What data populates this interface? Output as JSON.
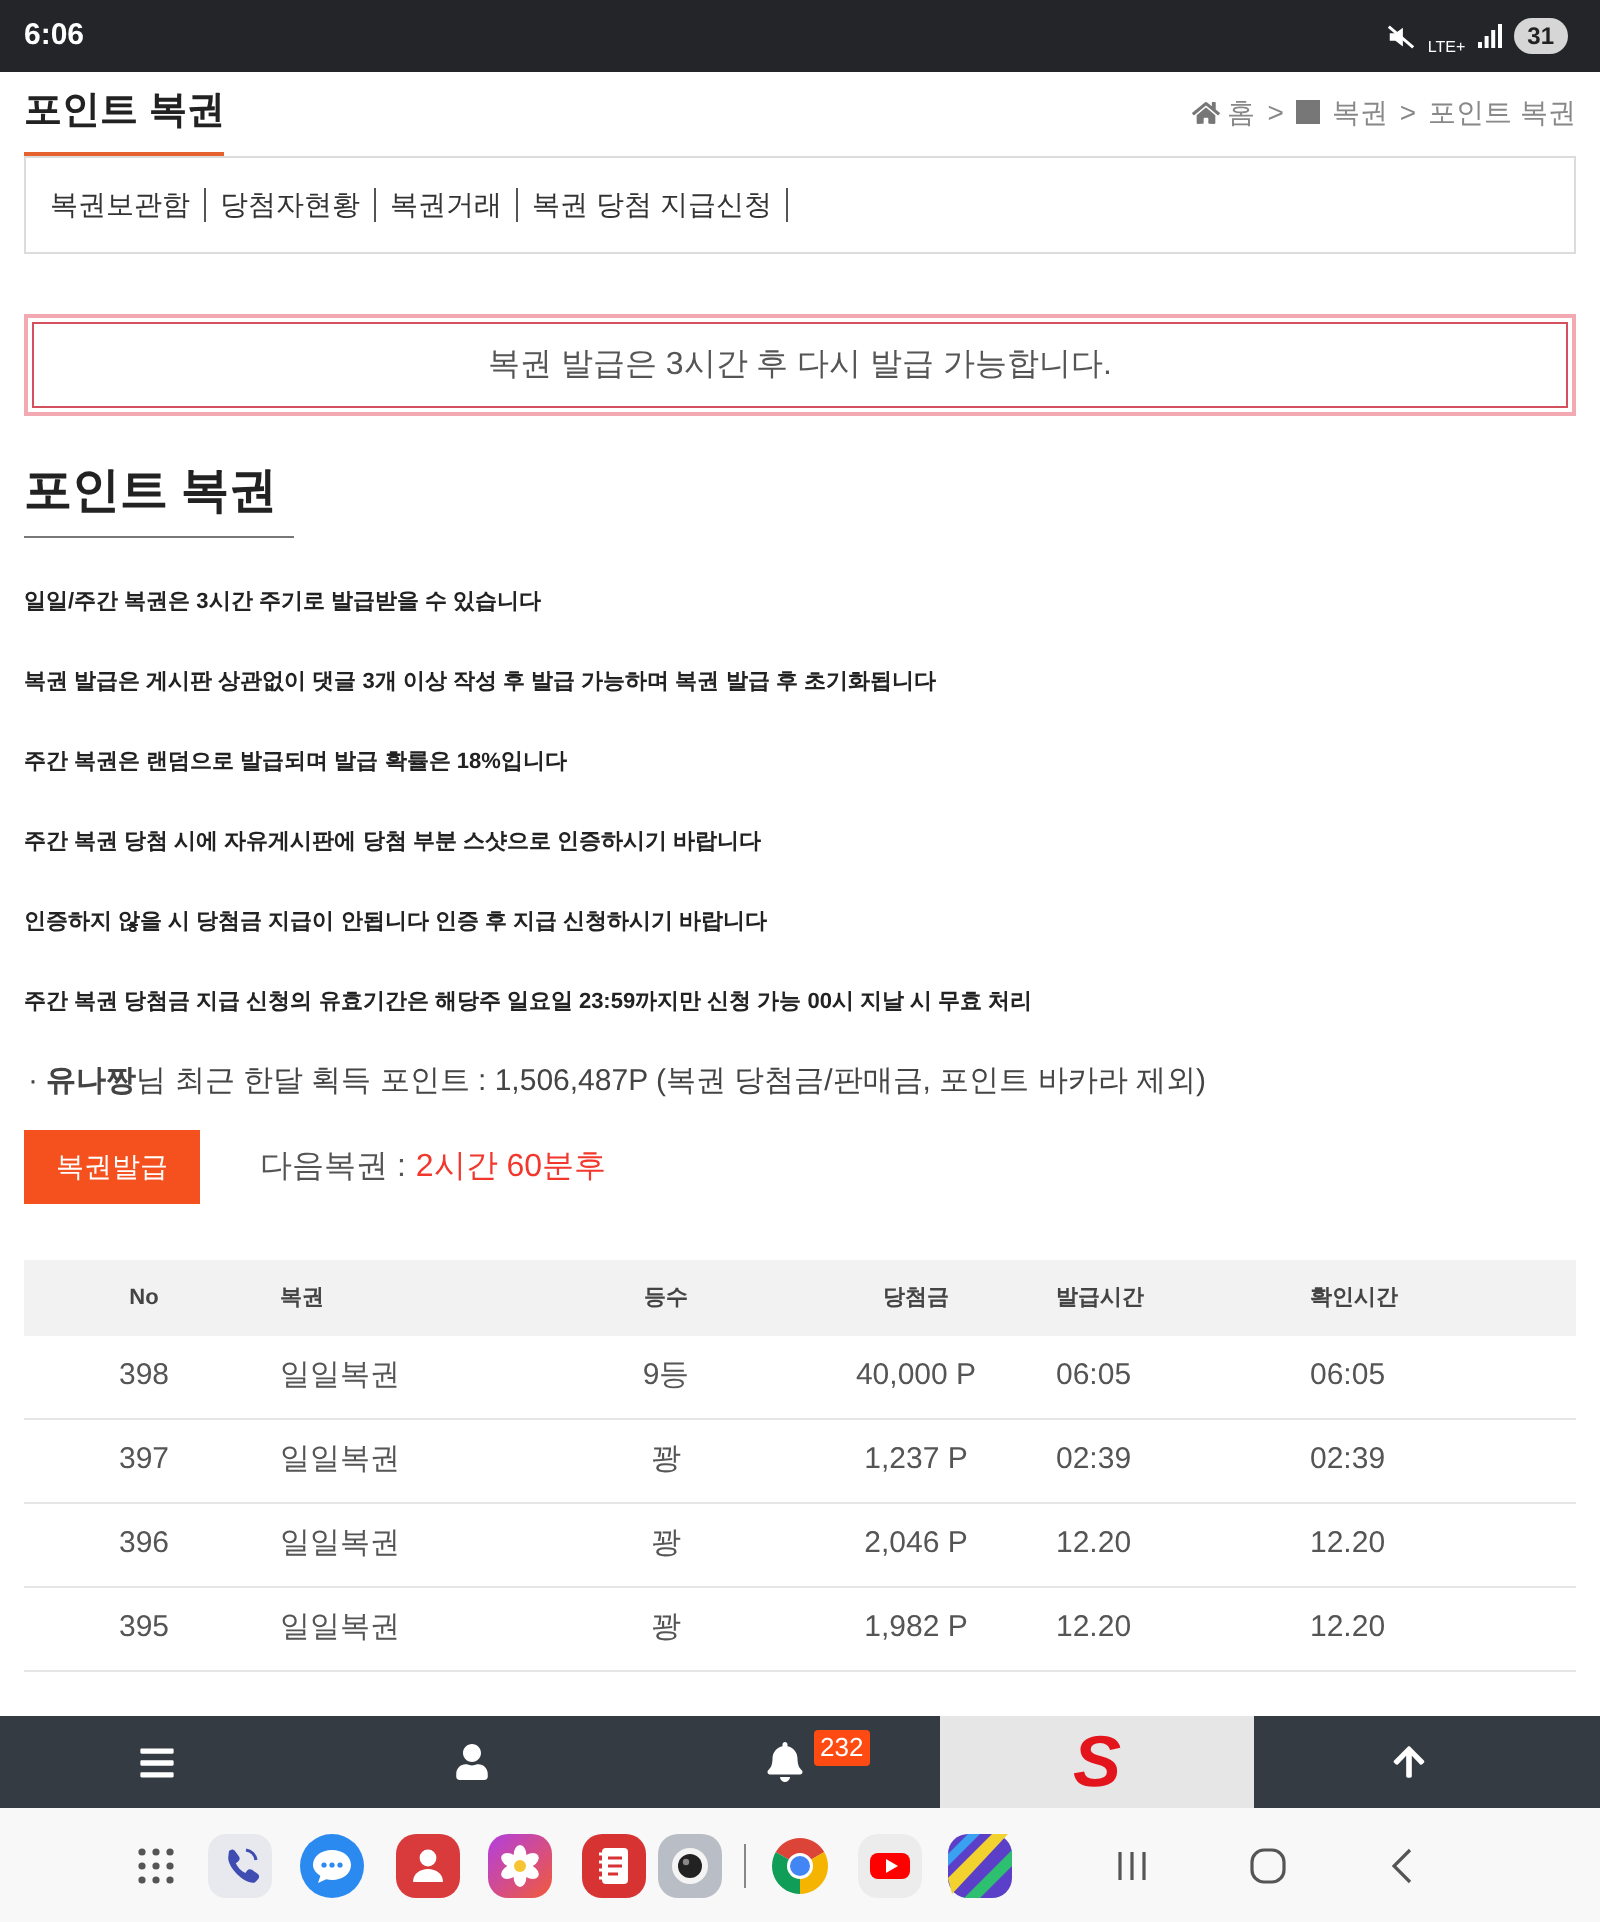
{
  "status_bar": {
    "time": "6:06",
    "network": "LTE+",
    "battery": "31"
  },
  "header": {
    "title": "포인트 복권",
    "breadcrumb": [
      {
        "kind": "home",
        "label": "홈"
      },
      {
        "kind": "separator",
        "label": ">"
      },
      {
        "kind": "board",
        "label": "복권"
      },
      {
        "kind": "separator",
        "label": ">"
      },
      {
        "kind": "page",
        "label": "포인트 복권"
      }
    ]
  },
  "sub_nav": [
    {
      "label": "복권보관함"
    },
    {
      "label": "당첨자현황"
    },
    {
      "label": "복권거래"
    },
    {
      "label": "복권 당첨 지급신청"
    }
  ],
  "alert": {
    "message": "복권 발급은 3시간 후 다시 발급 가능합니다."
  },
  "section": {
    "title": "포인트 복권",
    "notices": [
      "일일/주간 복권은 3시간 주기로 발급받을 수 있습니다",
      "복권 발급은 게시판 상관없이 댓글 3개 이상 작성 후 발급 가능하며 복권 발급 후 초기화됩니다",
      "주간 복권은 랜덤으로 발급되며 발급 확률은 18%입니다",
      "주간 복권 당첨 시에 자유게시판에 당첨 부분 스샷으로 인증하시기 바랍니다",
      "인증하지 않을 시 당첨금 지급이 안됩니다 인증 후 지급 신청하시기 바랍니다",
      "주간 복권 당첨금 지급 신청의 유효기간은 해당주 일요일 23:59까지만 신청 가능 00시 지날 시 무효 처리"
    ]
  },
  "points_summary": "· **유나짱**님 최근 한달 획득 포인트 : 1,506,487P (복권 당첨금/판매금, 포인트 바카라 제외)",
  "issue_button": "복권발급",
  "next_lottery": {
    "label": "다음복권 :",
    "time": "2시간 60분후"
  },
  "table": {
    "columns": [
      "No",
      "복권",
      "등수",
      "당첨금",
      "발급시간",
      "확인시간"
    ],
    "rows": [
      [
        "398",
        "일일복권",
        "9등",
        "40,000 P",
        "06:05",
        "06:05"
      ],
      [
        "397",
        "일일복권",
        "꽝",
        "1,237 P",
        "02:39",
        "02:39"
      ],
      [
        "396",
        "일일복권",
        "꽝",
        "2,046 P",
        "12.20",
        "12.20"
      ],
      [
        "395",
        "일일복권",
        "꽝",
        "1,982 P",
        "12.20",
        "12.20"
      ]
    ]
  },
  "bottom_nav": [
    {
      "kind": "menu"
    },
    {
      "kind": "user"
    },
    {
      "kind": "bell",
      "badge": "232"
    },
    {
      "kind": "logo",
      "label": "S"
    },
    {
      "kind": "top"
    }
  ]
}
